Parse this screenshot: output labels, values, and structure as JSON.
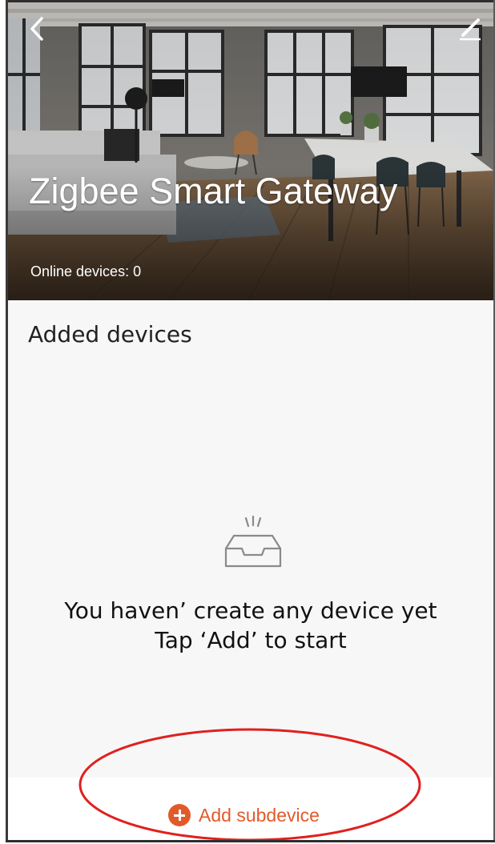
{
  "header": {
    "back_icon": "chevron-left-icon",
    "edit_icon": "pencil-icon",
    "title": "Zigbee Smart Gateway",
    "online_devices": "Online devices: 0"
  },
  "main": {
    "section_title": "Added devices",
    "empty_icon": "empty-tray-icon",
    "empty_line1": "You haven’ create any device yet",
    "empty_line2": "Tap ‘Add’ to start"
  },
  "footer": {
    "add_icon": "plus-circle-icon",
    "add_label": "Add subdevice"
  },
  "colors": {
    "accent": "#e35a2a",
    "annotation": "#e0201e"
  }
}
